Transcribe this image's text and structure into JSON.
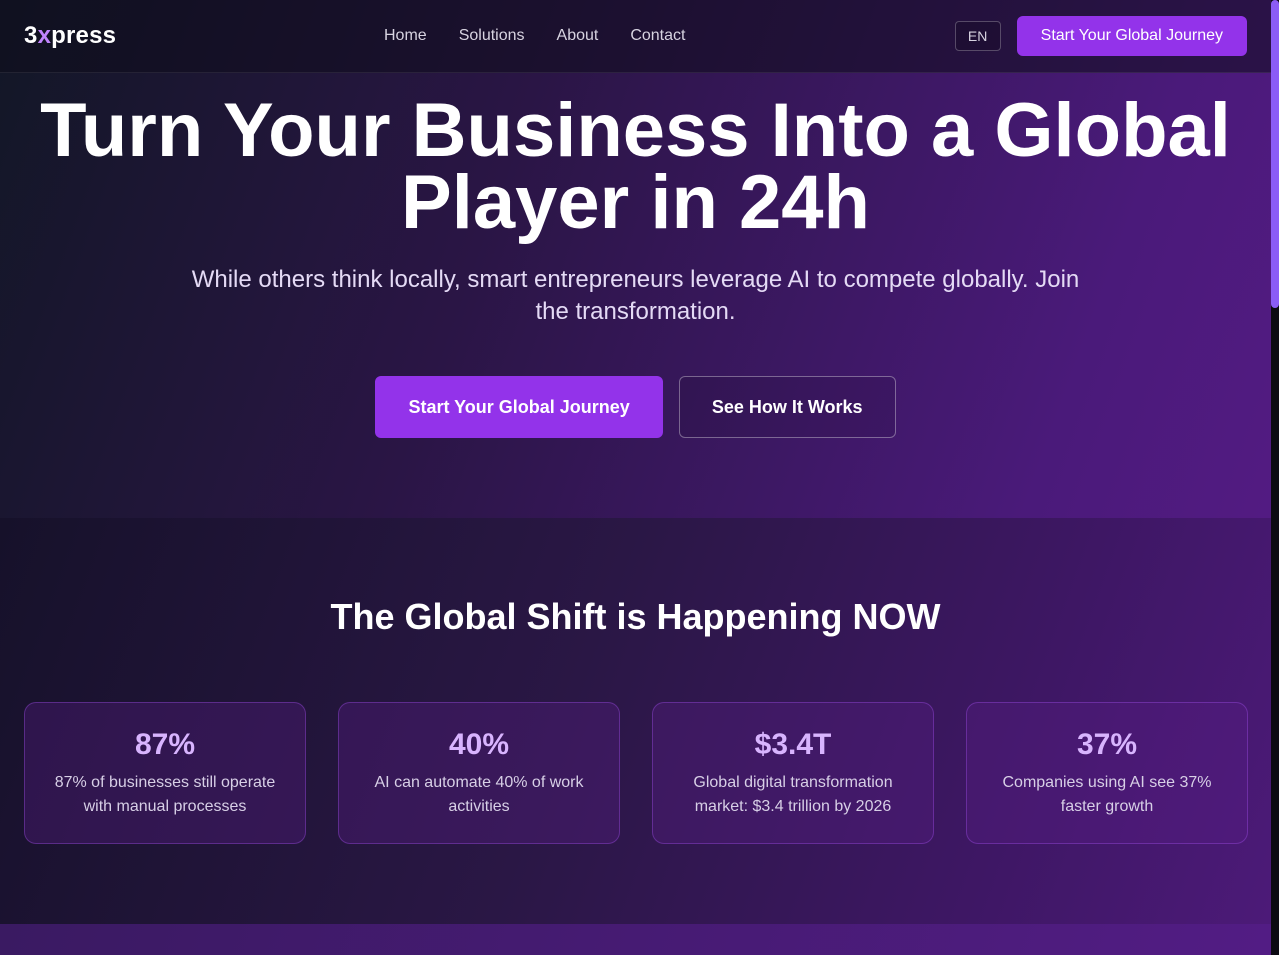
{
  "nav": {
    "logo_prefix": "3",
    "logo_x": "x",
    "logo_suffix": "press",
    "links": [
      "Home",
      "Solutions",
      "About",
      "Contact"
    ],
    "lang": "EN",
    "cta": "Start Your Global Journey"
  },
  "hero": {
    "title": "Turn Your Business Into a Global Player in 24h",
    "subtitle": "While others think locally, smart entrepreneurs leverage AI to compete globally. Join the transformation.",
    "primary_button": "Start Your Global Journey",
    "secondary_button": "See How It Works"
  },
  "stats": {
    "heading": "The Global Shift is Happening NOW",
    "cards": [
      {
        "value": "87%",
        "desc": "87% of businesses still operate with manual processes"
      },
      {
        "value": "40%",
        "desc": "AI can automate 40% of work activities"
      },
      {
        "value": "$3.4T",
        "desc": "Global digital transformation market: $3.4 trillion by 2026"
      },
      {
        "value": "37%",
        "desc": "Companies using AI see 37% faster growth"
      }
    ]
  },
  "colors": {
    "accent": "#9333ea",
    "stat_value": "#d8b4fe",
    "logo_x": "#c084fc"
  }
}
